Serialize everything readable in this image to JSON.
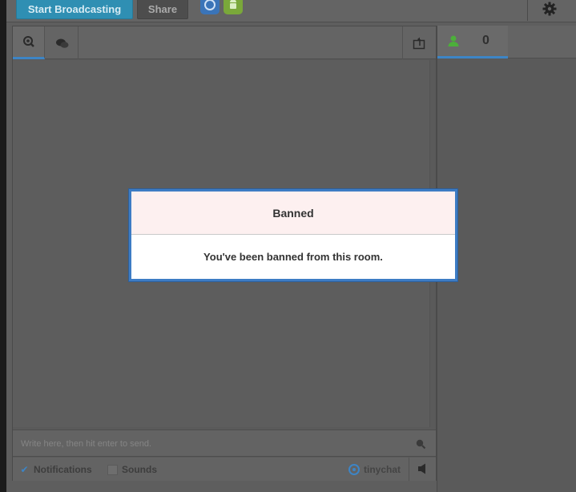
{
  "toolbar": {
    "broadcast_label": "Start Broadcasting",
    "share_label": "Share",
    "icons": [
      "ios-app-icon",
      "android-app-icon",
      "gear-icon"
    ]
  },
  "chat": {
    "tabs": [
      {
        "name": "zoom-icon",
        "active": true
      },
      {
        "name": "chat-bubbles-icon",
        "active": false
      },
      {
        "name": "popout-icon",
        "active": false
      }
    ],
    "input_placeholder": "Write here, then hit enter to send.",
    "notifications_label": "Notifications",
    "notifications_checked": true,
    "sounds_label": "Sounds",
    "sounds_checked": false,
    "brand": "tinychat"
  },
  "users": {
    "count": "0"
  },
  "modal": {
    "title": "Banned",
    "message": "You've been banned from this room."
  },
  "colors": {
    "accent": "#3d85c6",
    "broadcast_button": "#2f8fb3",
    "modal_title_bg": "#fdf0f0"
  }
}
